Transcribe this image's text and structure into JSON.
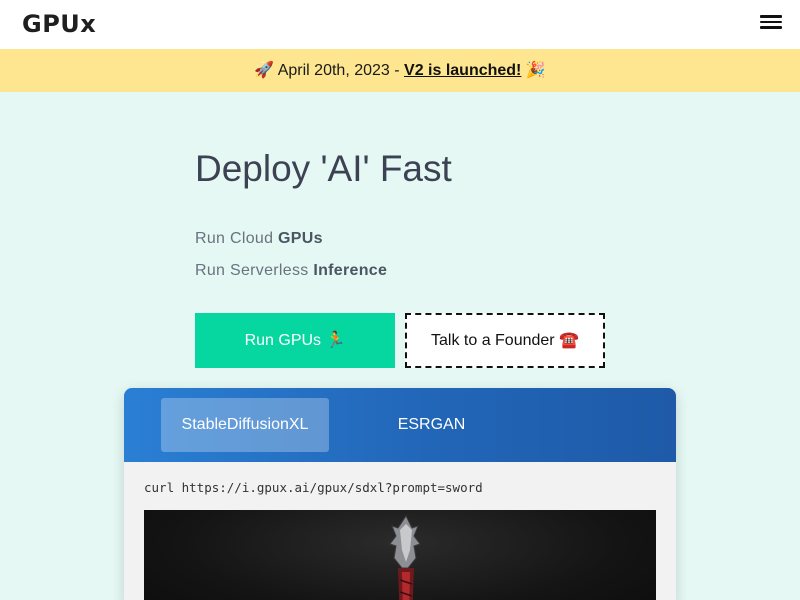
{
  "nav": {
    "logo": "GPUx",
    "menu_icon": "hamburger-menu-icon"
  },
  "banner": {
    "prefix": "🚀 April 20th, 2023 - ",
    "link": "V2 is launched!",
    "suffix": " 🎉"
  },
  "hero": {
    "title": "Deploy 'AI' Fast",
    "features": [
      {
        "prefix": "Run Cloud ",
        "bold": "GPUs"
      },
      {
        "prefix": "Run Serverless ",
        "bold": "Inference"
      }
    ]
  },
  "cta": {
    "primary": "Run GPUs 🏃",
    "secondary": "Talk to a Founder ☎️"
  },
  "demo": {
    "tabs": [
      "StableDiffusionXL",
      "ESRGAN"
    ],
    "active_tab": "StableDiffusionXL",
    "command": "curl https://i.gpux.ai/gpux/sdxl?prompt=sword",
    "image_icon": "sword-image-icon"
  },
  "colors": {
    "accent": "#06d6a0",
    "banner": "#fde68f",
    "background": "#e5f8f3",
    "tabs_bar": "#2266b8",
    "title": "#3c4253"
  }
}
